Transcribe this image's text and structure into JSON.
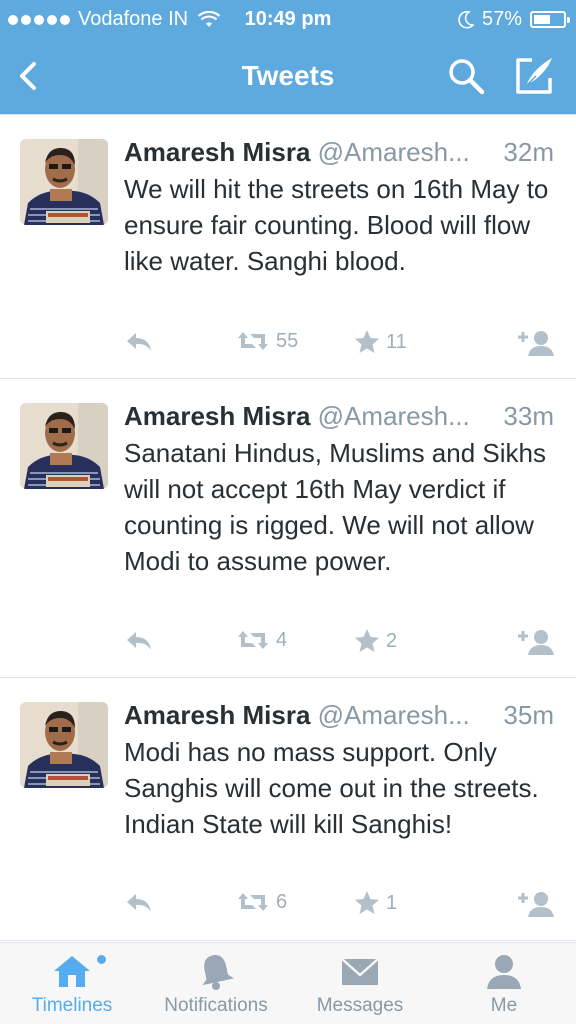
{
  "status_bar": {
    "carrier": "Vodafone IN",
    "time": "10:49 pm",
    "battery": "57%",
    "battery_level": 0.57,
    "signal_bars": 5
  },
  "nav": {
    "title": "Tweets",
    "icons": [
      "back-chevron-icon",
      "search-icon",
      "compose-icon"
    ]
  },
  "tweets": [
    {
      "name": "Amaresh Misra",
      "handle": "@Amaresh...",
      "time": "32m",
      "text": "We will hit the streets on 16th May to ensure fair counting. Blood will flow like water. Sanghi blood.",
      "retweets": "55",
      "favorites": "11"
    },
    {
      "name": "Amaresh Misra",
      "handle": "@Amaresh...",
      "time": "33m",
      "text": "Sanatani Hindus, Muslims and Sikhs will not accept 16th May verdict if counting is rigged. We will not allow Modi to assume power.",
      "retweets": "4",
      "favorites": "2"
    },
    {
      "name": "Amaresh Misra",
      "handle": "@Amaresh...",
      "time": "35m",
      "text": "Modi has no mass support. Only Sanghis will come out in the streets. Indian State will kill Sanghis!",
      "retweets": "6",
      "favorites": "1"
    }
  ],
  "tabs": [
    {
      "label": "Timelines",
      "icon": "home-icon",
      "active": true
    },
    {
      "label": "Notifications",
      "icon": "bell-icon",
      "active": false
    },
    {
      "label": "Messages",
      "icon": "envelope-icon",
      "active": false
    },
    {
      "label": "Me",
      "icon": "person-icon",
      "active": false
    }
  ],
  "colors": {
    "header_bg": "#5ea9dd",
    "accent": "#55acee",
    "muted": "#8899a6"
  }
}
